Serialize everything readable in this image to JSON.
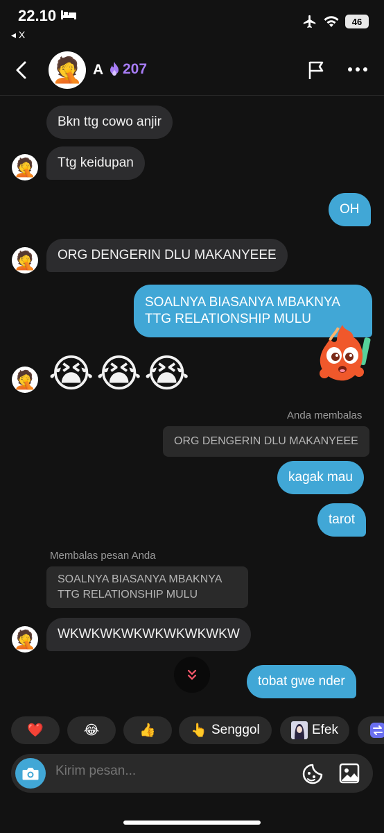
{
  "status_bar": {
    "time": "22.10",
    "back_app": "◂ X",
    "battery": "46"
  },
  "header": {
    "name": "A",
    "streak": "207"
  },
  "messages": {
    "m1": "Bkn ttg cowo anjir",
    "m2": "Ttg keidupan",
    "m3": "OH",
    "m4": "ORG DENGERIN DLU MAKANYEEE",
    "m5_line1": "SOALNYA BIASANYA MBAKNYA",
    "m5_line2": "TTG RELATIONSHIP MULU",
    "emoji1": "😭",
    "emoji2": "😭",
    "emoji3": "😭",
    "reply_label_out": "Anda membalas",
    "quote_out": "ORG DENGERIN DLU MAKANYEEE",
    "m6": "kagak mau",
    "m7": "tarot",
    "reply_label_in": "Membalas pesan Anda",
    "quote_in_line1": "SOALNYA BIASANYA MBAKNYA",
    "quote_in_line2": "TTG RELATIONSHIP MULU",
    "m8": "WKWKWKWKWKWKWKWKW",
    "m9": "tobat gwe nder"
  },
  "quick_reactions": {
    "heart": "❤️",
    "laugh": "😂",
    "thumbs": "👍",
    "poke_icon": "👆",
    "poke_label": "Senggol",
    "effect_label": "Efek"
  },
  "input": {
    "placeholder": "Kirim pesan..."
  },
  "colors": {
    "accent": "#41a7d6",
    "incoming": "#2c2c2e",
    "streak": "#a77cf5"
  }
}
